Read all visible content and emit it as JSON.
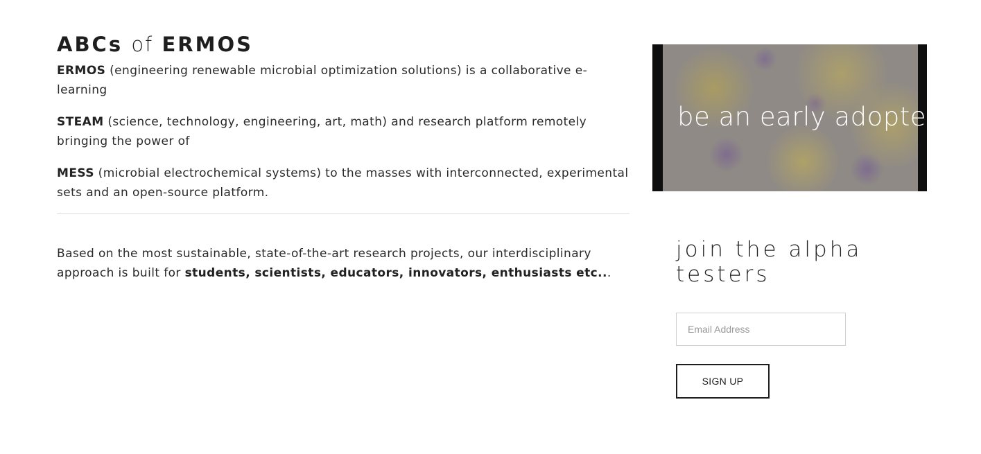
{
  "heading": {
    "part1": "ABCs",
    "part2": "of",
    "part3": "ERMOS"
  },
  "intro": [
    {
      "term": "ERMOS",
      "text": " (engineering renewable microbial optimization solutions) is a collaborative e-learning"
    },
    {
      "term": "STEAM",
      "text": " (science, technology, engineering, art, math) and research platform remotely bringing the power of"
    },
    {
      "term": "MESS",
      "text": " (microbial electrochemical systems) to the masses with interconnected, experimental sets and an open-source platform."
    }
  ],
  "approach": {
    "text": "Based on the most sustainable, state-of-the-art research projects, our interdisciplinary approach is built for ",
    "audience": "students, scientists, educators, innovators, enthusiasts etc..",
    "end": "."
  },
  "banner": {
    "text": "be an early adopter"
  },
  "signup_form": {
    "title": "join the alpha testers",
    "email_placeholder": "Email Address",
    "button_label": "SIGN UP"
  }
}
